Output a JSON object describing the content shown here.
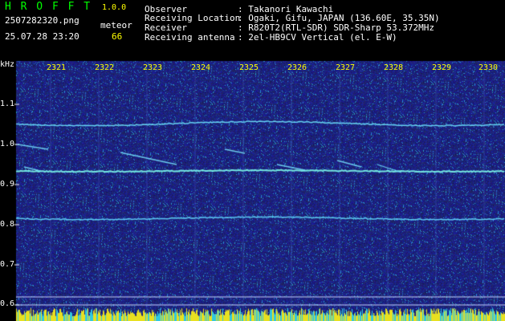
{
  "app": {
    "name": "H R O F F T",
    "version": "1.0.0"
  },
  "file": {
    "name": "2507282320.png",
    "datetime": "25.07.28 23:20"
  },
  "meteor": {
    "label": "meteor",
    "count": "66"
  },
  "info": [
    {
      "key": "Observer",
      "value": ": Takanori Kawachi"
    },
    {
      "key": "Receiving Location",
      "value": ": Ogaki, Gifu, JAPAN (136.60E, 35.35N)"
    },
    {
      "key": "Receiver",
      "value": ": R820T2(RTL-SDR) SDR-Sharp 53.372MHz"
    },
    {
      "key": "Receiving antenna",
      "value": ": 2el-HB9CV Vertical (el. E-W)"
    }
  ],
  "axis": {
    "y_unit": "kHz",
    "y_ticks": [
      "1.1",
      "1.0",
      "0.9",
      "0.8",
      "0.7",
      "0.6"
    ],
    "x_ticks": [
      "2321",
      "2322",
      "2323",
      "2324",
      "2325",
      "2326",
      "2327",
      "2328",
      "2329",
      "2330"
    ]
  },
  "colors": {
    "title": "#00ff00",
    "version": "#ffff00",
    "meteor_count": "#ffff00",
    "background_noise": "#1a1a78",
    "signal": "#60e0ff"
  }
}
